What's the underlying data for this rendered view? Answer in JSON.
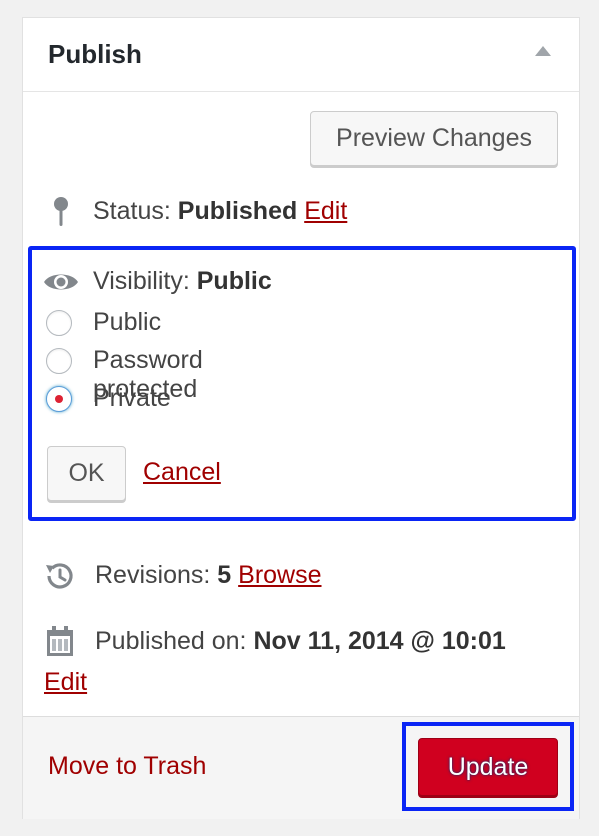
{
  "box": {
    "title": "Publish"
  },
  "actions": {
    "preview_label": "Preview Changes"
  },
  "status": {
    "label": "Status:",
    "value": "Published",
    "edit_label": "Edit"
  },
  "visibility": {
    "label": "Visibility:",
    "value": "Public",
    "options": [
      {
        "label": "Public",
        "checked": false
      },
      {
        "label": "Password protected",
        "checked": false
      },
      {
        "label": "Private",
        "checked": true
      }
    ],
    "ok_label": "OK",
    "cancel_label": "Cancel"
  },
  "revisions": {
    "label": "Revisions:",
    "count": "5",
    "browse_label": "Browse"
  },
  "published": {
    "label": "Published on:",
    "value": "Nov 11, 2014 @ 10:01",
    "edit_label": "Edit"
  },
  "footer": {
    "trash_label": "Move to Trash",
    "update_label": "Update"
  },
  "icons": {
    "status": "pin-icon",
    "visibility": "eye-icon",
    "revisions": "history-icon",
    "published": "calendar-icon"
  },
  "colors": {
    "link": "#a00000",
    "primary_button": "#d0001f",
    "highlight_frame": "#0a25f5",
    "radio_dot": "#dd2233"
  }
}
